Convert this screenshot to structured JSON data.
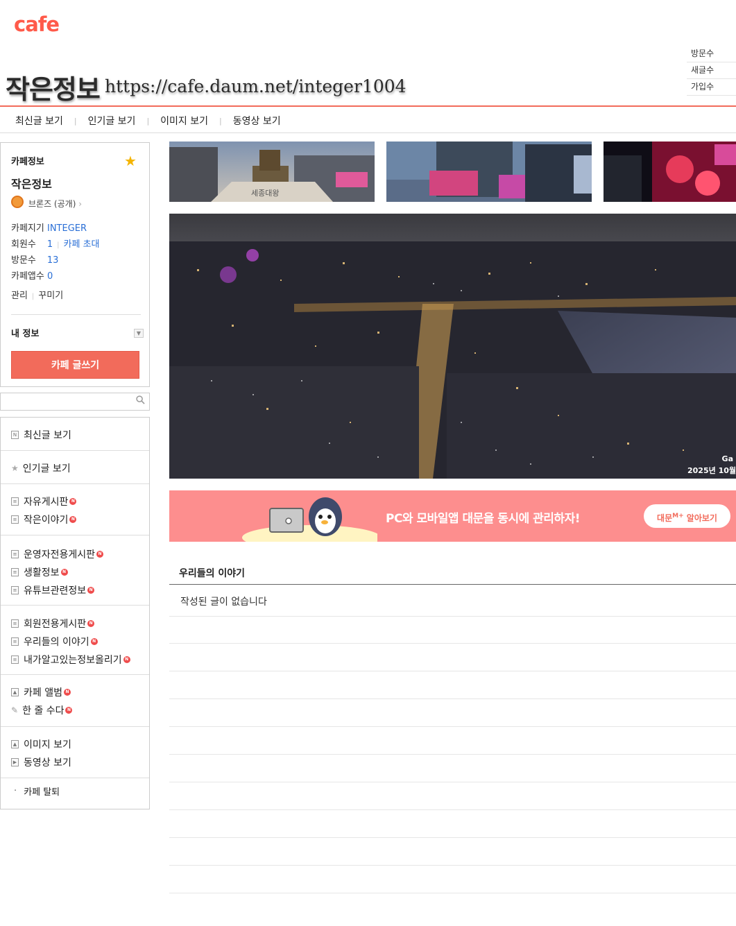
{
  "header": {
    "logo": "cafe",
    "cafe_name": "작은정보",
    "cafe_url": "https://cafe.daum.net/integer1004",
    "stats": [
      "방문수",
      "새글수",
      "가입수"
    ]
  },
  "topnav": [
    "최신글 보기",
    "인기글 보기",
    "이미지 보기",
    "동영상 보기"
  ],
  "sidebar": {
    "heading": "카페정보",
    "cafe_name": "작은정보",
    "grade": "브론즈 (공개)",
    "owner_label": "카페지기",
    "owner_value": "INTEGER",
    "members_label": "회원수",
    "members_value": "1",
    "invite_label": "카페 초대",
    "visits_label": "방문수",
    "visits_value": "13",
    "app_label": "카페앱수",
    "app_value": "0",
    "manage": "관리",
    "decorate": "꾸미기",
    "my_info": "내 정보",
    "write_button": "카페 글쓰기"
  },
  "menu": {
    "recent": "최신글 보기",
    "popular": "인기글 보기",
    "free_board": "자유게시판",
    "small_story": "작은이야기",
    "admin_board": "운영자전용게시판",
    "life_info": "생활정보",
    "youtube_info": "유튜브관련정보",
    "member_board": "회원전용게시판",
    "our_story": "우리들의 이야기",
    "share_info": "내가알고있는정보올리기",
    "album": "카페 앨범",
    "one_line": "한 줄 수다",
    "images": "이미지 보기",
    "videos": "동영상 보기",
    "leave": "카페 탈퇴",
    "new_badge": "N"
  },
  "hero": {
    "caption_top": "Ga",
    "caption_bottom": "2025년 10월"
  },
  "thumbs": {
    "first_sign": "세종대왕"
  },
  "banner": {
    "text": "PC와 모바일앱 대문을 동시에 관리하자!",
    "button_main": "대문",
    "button_sup": "M+",
    "button_tail": " 알아보기"
  },
  "board": {
    "title": "우리들의 이야기",
    "empty": "작성된 글이 없습니다"
  },
  "colors": {
    "accent": "#f26b5b",
    "banner": "#fd8e8e",
    "link": "#2a6fd6"
  }
}
